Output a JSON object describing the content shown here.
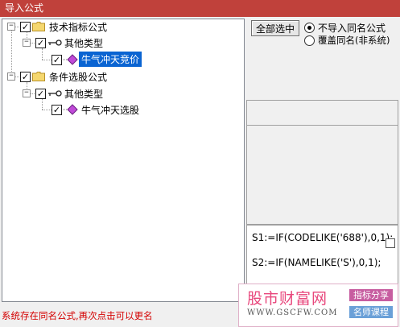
{
  "window": {
    "title": "导入公式"
  },
  "tree": {
    "groups": [
      {
        "label": "技术指标公式",
        "checked": true,
        "subgroup": {
          "label": "其他类型",
          "checked": true,
          "item": {
            "label": "牛气冲天竞价",
            "checked": true,
            "selected": true
          }
        }
      },
      {
        "label": "条件选股公式",
        "checked": true,
        "subgroup": {
          "label": "其他类型",
          "checked": true,
          "item": {
            "label": "牛气冲天选股",
            "checked": true,
            "selected": false
          }
        }
      }
    ]
  },
  "toolbar": {
    "select_all_label": "全部选中"
  },
  "options": {
    "skip_same_name_label": "不导入同名公式",
    "overwrite_label": "覆盖同名(非系统)",
    "selected": "skip_same_name"
  },
  "formula": {
    "lines": [
      "S1:=IF(CODELIKE('688'),0,1);",
      "S2:=IF(NAMELIKE('S'),0,1);"
    ]
  },
  "status": {
    "message": "系统存在同名公式,再次点击可以更名"
  },
  "watermark": {
    "site_name": "股市财富网",
    "url": "www.gscfw.com",
    "tag1": "指标分享",
    "tag2": "名师课程"
  },
  "colors": {
    "titlebar": "#c0413b",
    "selection": "#0a64d2",
    "status_text": "#d40000",
    "watermark_pink": "#e8477c",
    "watermark_tag1": "#c75da0",
    "watermark_tag2": "#6aa0d8"
  }
}
